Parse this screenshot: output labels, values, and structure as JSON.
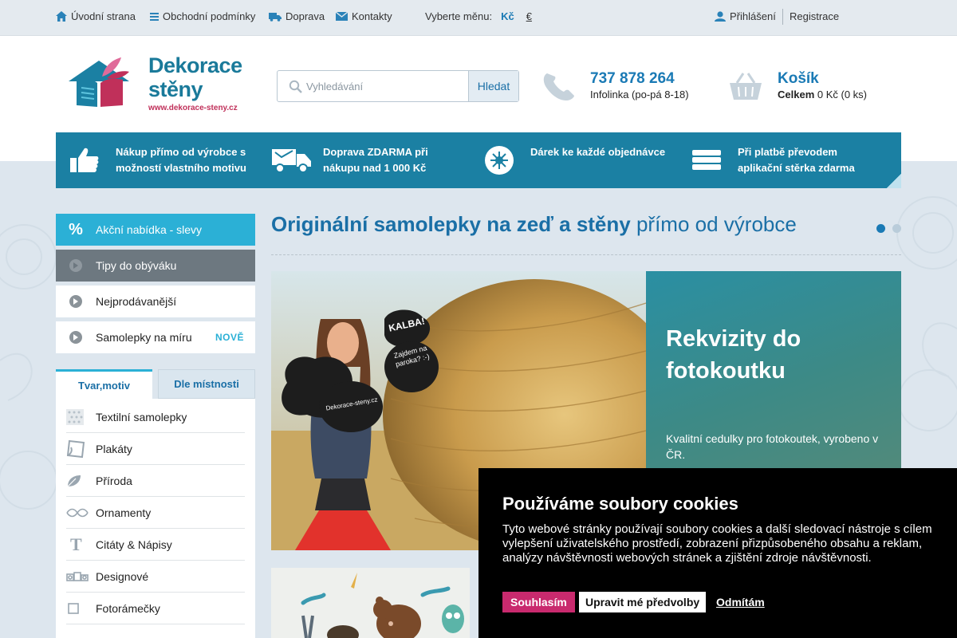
{
  "topbar": {
    "home": "Úvodní strana",
    "terms": "Obchodní podmínky",
    "shipping": "Doprava",
    "contacts": "Kontakty",
    "currency_label": "Vyberte měnu:",
    "currency_czk": "Kč",
    "currency_eur": "€",
    "login": "Přihlášení",
    "register": "Registrace"
  },
  "logo": {
    "line1": "Dekorace",
    "line2": "stěny",
    "url": "www.dekorace-steny.cz"
  },
  "search": {
    "placeholder": "Vyhledávání",
    "button": "Hledat"
  },
  "phone": {
    "number": "737 878 264",
    "hours": "Infolinka (po-pá 8-18)"
  },
  "cart": {
    "title": "Košík",
    "total_label": "Celkem",
    "total_value": "0 Kč (0 ks)"
  },
  "benefits": [
    {
      "text": "Nákup přímo od výrobce s možností vlastního motivu",
      "icon": "thumbs-up-icon"
    },
    {
      "text": "Doprava ZDARMA při nákupu nad 1 000 Kč",
      "icon": "truck-icon"
    },
    {
      "text": "Dárek ke každé objednávce",
      "icon": "gift-icon"
    },
    {
      "text": "Při platbě převodem aplikační stěrka zdarma",
      "icon": "card-icon"
    }
  ],
  "left_menu": [
    {
      "label": "Akční nabídka - slevy",
      "icon": "percent-icon"
    },
    {
      "label": "Tipy do obýváku",
      "icon": "arrow-circle-icon"
    },
    {
      "label": "Nejprodávanější",
      "icon": "arrow-circle-icon"
    },
    {
      "label": "Samolepky na míru",
      "icon": "arrow-circle-icon",
      "badge": "NOVĚ"
    }
  ],
  "tabs": {
    "tab1": "Tvar,motiv",
    "tab2": "Dle místnosti"
  },
  "categories": [
    {
      "label": "Textilní samolepky",
      "icon": "textile-icon"
    },
    {
      "label": "Plakáty",
      "icon": "poster-icon"
    },
    {
      "label": "Příroda",
      "icon": "leaf-icon"
    },
    {
      "label": "Ornamenty",
      "icon": "ornament-icon"
    },
    {
      "label": "Citáty & Nápisy",
      "icon": "text-t-icon"
    },
    {
      "label": "Designové",
      "icon": "design-icon"
    },
    {
      "label": "Fotorámečky",
      "icon": "frame-icon"
    }
  ],
  "headline": {
    "bold": "Originální samolepky na zeď a stěny",
    "light": "přímo od výrobce"
  },
  "slide": {
    "title": "Rekvizity do fotokoutku",
    "description": "Kvalitní cedulky pro fotokoutek, vyrobeno v ČR.",
    "sign1": "KALBA!",
    "sign2": "Zajdem na paroka? :-)",
    "sign3": "Dekorace-steny.cz"
  },
  "cookie": {
    "title": "Používáme soubory cookies",
    "text": "Tyto webové stránky používají soubory cookies a další sledovací nástroje s cílem vylepšení uživatelského prostředí, zobrazení přizpůsobeného obsahu a reklam, analýzy návštěvnosti webových stránek a zjištění zdroje návštěvnosti.",
    "accept": "Souhlasím",
    "prefs": "Upravit mé předvolby",
    "decline": "Odmítám"
  },
  "colors": {
    "accent": "#1a7ab5",
    "benefit_bar": "#1b80a3",
    "menu_active": "#2bb0d6",
    "cookie_accept": "#c92a6e"
  }
}
